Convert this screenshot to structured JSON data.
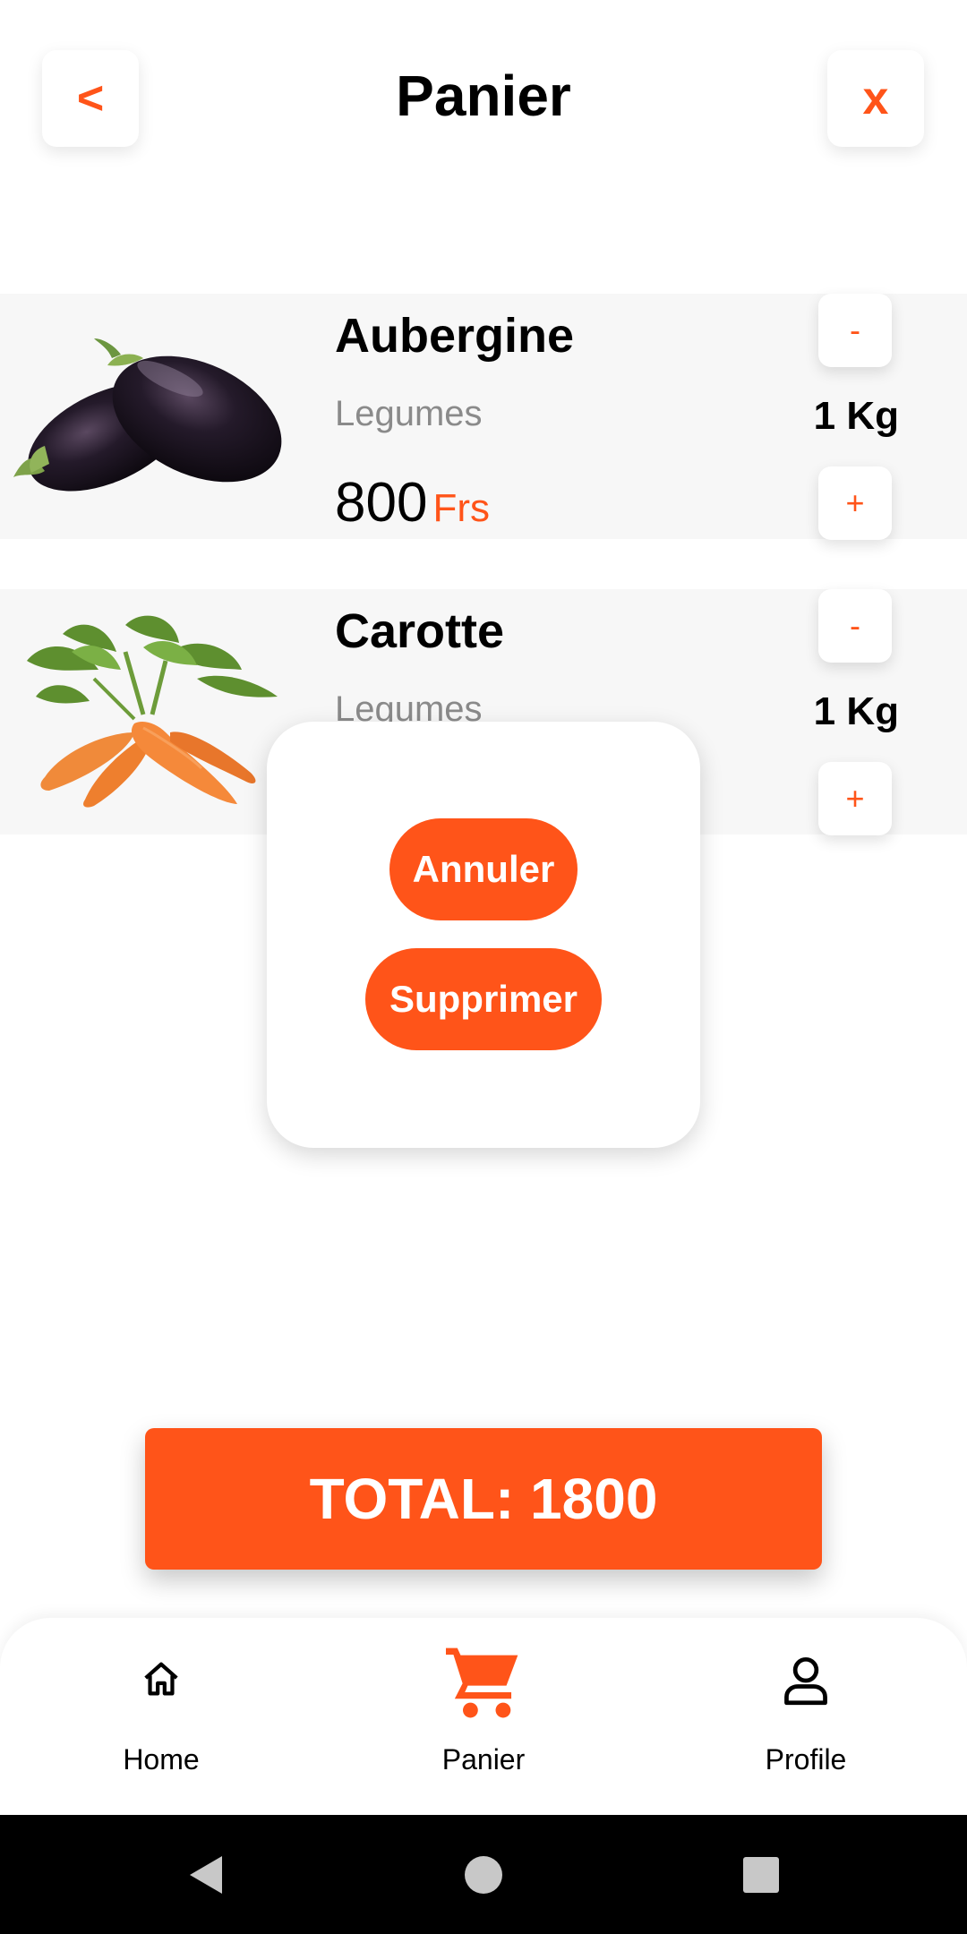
{
  "header": {
    "title": "Panier",
    "back_label": "<",
    "close_label": "x"
  },
  "items": [
    {
      "name": "Aubergine",
      "category": "Legumes",
      "price": "800",
      "currency": "Frs",
      "quantity": "1 Kg",
      "minus_label": "-",
      "plus_label": "+",
      "image_icon": "eggplant-image"
    },
    {
      "name": "Carotte",
      "category": "Legumes",
      "quantity": "1 Kg",
      "minus_label": "-",
      "plus_label": "+",
      "image_icon": "carrot-image"
    }
  ],
  "dialog": {
    "cancel_label": "Annuler",
    "delete_label": "Supprimer"
  },
  "total": {
    "label": "TOTAL: 1800"
  },
  "nav": {
    "items": [
      {
        "label": "Home",
        "icon": "home-icon",
        "active": false
      },
      {
        "label": "Panier",
        "icon": "cart-icon",
        "active": true
      },
      {
        "label": "Profile",
        "icon": "profile-icon",
        "active": false
      }
    ]
  },
  "colors": {
    "accent": "#ff5419",
    "item_bg": "#f7f7f7",
    "muted_text": "#8a8a8a"
  }
}
